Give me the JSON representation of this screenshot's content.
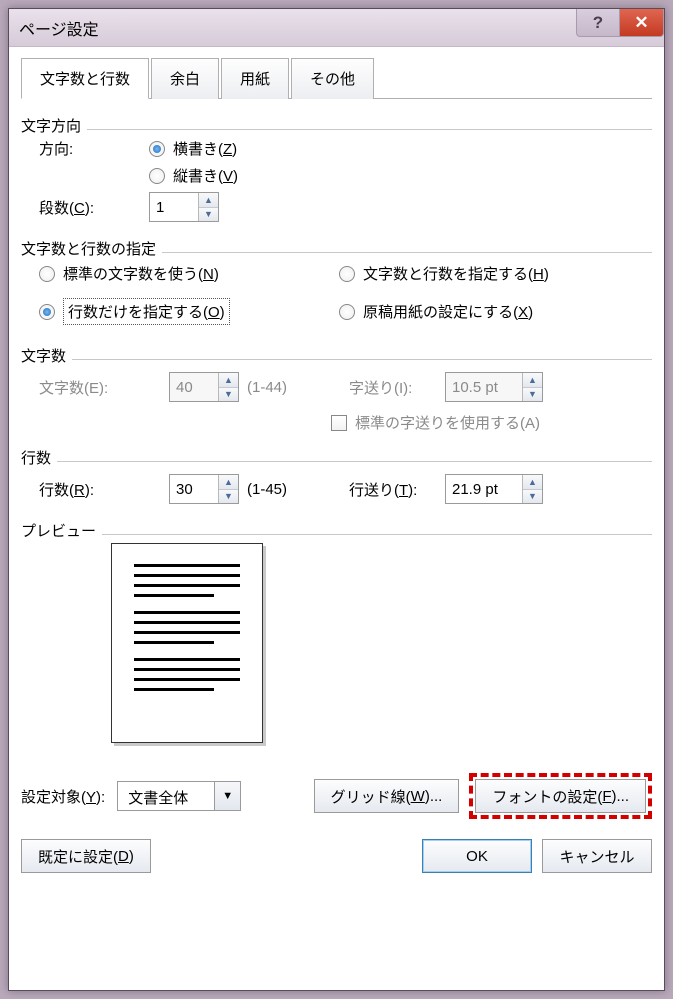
{
  "window": {
    "title": "ページ設定"
  },
  "tabs": {
    "chars_lines": "文字数と行数",
    "margins": "余白",
    "paper": "用紙",
    "other": "その他"
  },
  "direction": {
    "section": "文字方向",
    "label": "方向:",
    "horizontal_pre": "横書き(",
    "horizontal_key": "Z",
    "horizontal_post": ")",
    "vertical_pre": "縦書き(",
    "vertical_key": "V",
    "vertical_post": ")",
    "columns_label_pre": "段数(",
    "columns_label_key": "C",
    "columns_label_post": "):",
    "columns_value": "1"
  },
  "spec": {
    "section": "文字数と行数の指定",
    "standard_pre": "標準の文字数を使う(",
    "standard_key": "N",
    "standard_post": ")",
    "chars_lines_pre": "文字数と行数を指定する(",
    "chars_lines_key": "H",
    "chars_lines_post": ")",
    "lines_only_pre": "行数だけを指定する(",
    "lines_only_key": "O",
    "lines_only_post": ")",
    "genko_pre": "原稿用紙の設定にする(",
    "genko_key": "X",
    "genko_post": ")"
  },
  "chars": {
    "section": "文字数",
    "count_label": "文字数(E):",
    "count_value": "40",
    "count_range": "(1-44)",
    "pitch_label": "字送り(I):",
    "pitch_value": "10.5 pt",
    "std_pitch_label": "標準の字送りを使用する(A)"
  },
  "lines": {
    "section": "行数",
    "count_label_pre": "行数(",
    "count_label_key": "R",
    "count_label_post": "):",
    "count_value": "30",
    "count_range": "(1-45)",
    "pitch_label_pre": "行送り(",
    "pitch_label_key": "T",
    "pitch_label_post": "):",
    "pitch_value": "21.9 pt"
  },
  "preview": {
    "section": "プレビュー"
  },
  "apply": {
    "label_pre": "設定対象(",
    "label_key": "Y",
    "label_post": "):",
    "value": "文書全体",
    "grid_pre": "グリッド線(",
    "grid_key": "W",
    "grid_post": ")...",
    "font_pre": "フォントの設定(",
    "font_key": "F",
    "font_post": ")..."
  },
  "footer": {
    "default_pre": "既定に設定(",
    "default_key": "D",
    "default_post": ")",
    "ok": "OK",
    "cancel": "キャンセル"
  }
}
